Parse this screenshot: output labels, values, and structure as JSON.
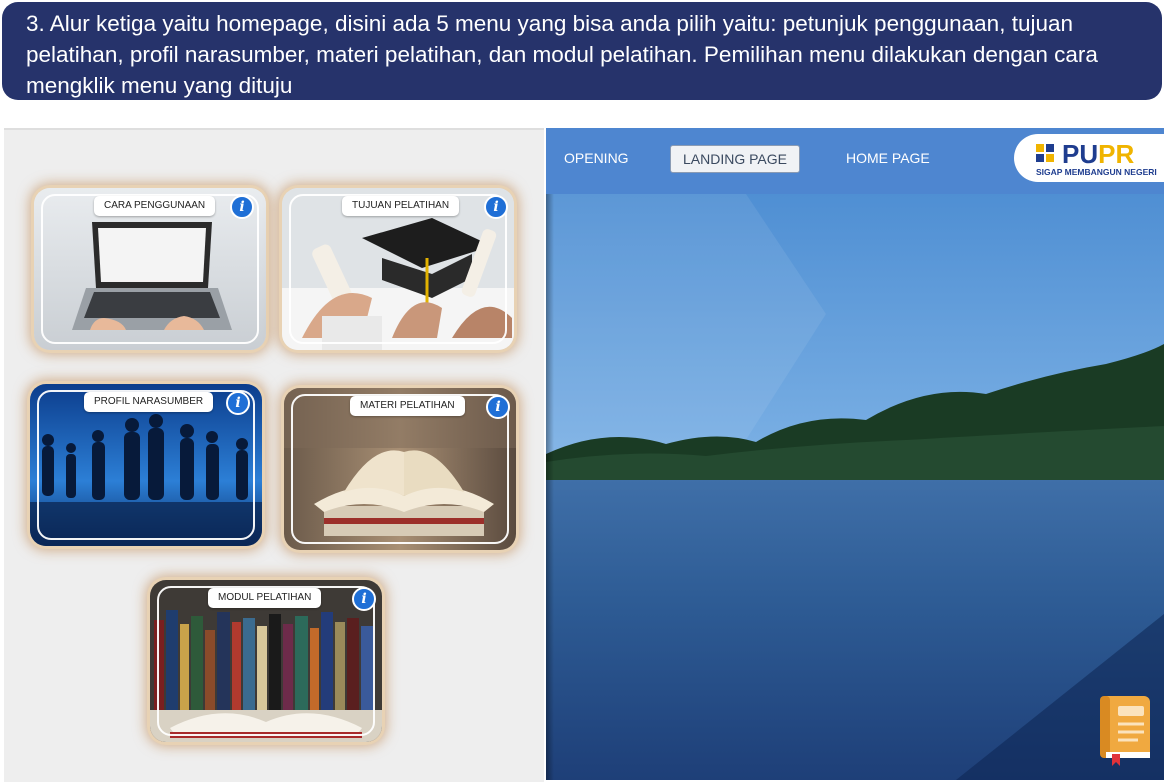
{
  "banner": {
    "text": "3. Alur ketiga yaitu homepage, disini ada 5 menu yang bisa anda pilih yaitu: petunjuk penggunaan, tujuan pelatihan, profil narasumber, materi pelatihan, dan modul pelatihan. Pemilihan menu dilakukan dengan cara mengklik menu yang dituju"
  },
  "menu": {
    "cards": [
      {
        "label": "CARA PENGGUNAAN",
        "image": "laptop-typing",
        "info_icon": "info-icon"
      },
      {
        "label": "TUJUAN PELATIHAN",
        "image": "graduation-caps",
        "info_icon": "info-icon"
      },
      {
        "label": "PROFIL NARASUMBER",
        "image": "business-silhouettes",
        "info_icon": "info-icon"
      },
      {
        "label": "MATERI PELATIHAN",
        "image": "open-book",
        "info_icon": "info-icon"
      },
      {
        "label": "MODUL PELATIHAN",
        "image": "library-books",
        "info_icon": "info-icon"
      }
    ],
    "info_glyph": "i"
  },
  "nav": {
    "opening": "OPENING",
    "landing": "LANDING PAGE",
    "home": "HOME PAGE"
  },
  "logo": {
    "text_blue": "PU",
    "text_yellow": "PR",
    "tagline": "SIGAP MEMBANGUN NEGERI"
  },
  "colors": {
    "banner_bg": "#26336b",
    "navbar_bg": "#4e86d0",
    "info_blue": "#1f6fd6",
    "logo_blue": "#1f3d8f",
    "logo_yellow": "#f0b400",
    "book_orange": "#f0a940"
  },
  "icons": {
    "book_button": "book-icon"
  }
}
